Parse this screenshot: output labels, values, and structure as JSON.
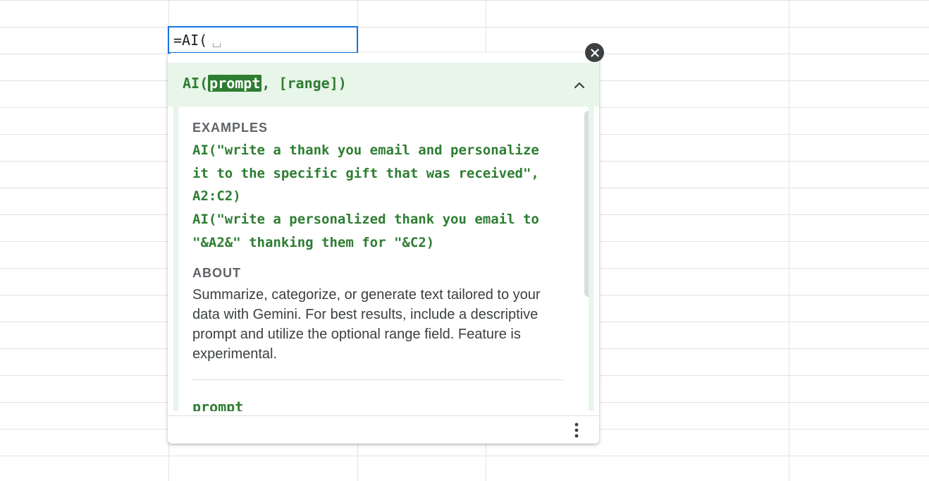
{
  "cell_editor": {
    "value": "=AI("
  },
  "formula_help": {
    "signature": {
      "prefix": "AI(",
      "active_param": "prompt",
      "suffix": ", [range])"
    },
    "examples_label": "EXAMPLES",
    "examples": [
      "AI(\"write a thank you email and personalize it to the specific gift that was received\", A2:C2)",
      "AI(\"write a personalized thank you email to \"&A2&\" thanking them for \"&C2)"
    ],
    "about_label": "ABOUT",
    "about_text": "Summarize, categorize, or generate text tailored to your data with Gemini. For best results, include a descriptive prompt and utilize the optional range field. Feature is experimental.",
    "param_name": "prompt"
  },
  "icons": {
    "close": "close-icon",
    "collapse": "chevron-up-icon",
    "more": "more-vert-icon"
  },
  "colors": {
    "accent_green": "#2e7d32",
    "header_bg": "#e8f5e9",
    "selection_blue": "#1a73e8"
  }
}
